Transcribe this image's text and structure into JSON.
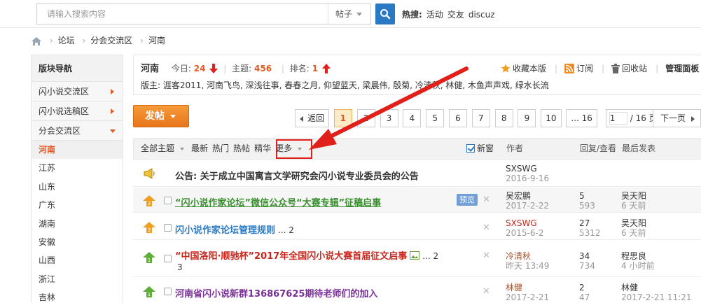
{
  "search": {
    "placeholder": "请输入搜索内容",
    "type": "帖子"
  },
  "hot": {
    "label": "热搜:",
    "items": [
      "活动",
      "交友",
      "discuz"
    ]
  },
  "breadcrumb": [
    "论坛",
    "分会交流区",
    "河南"
  ],
  "sidebar": {
    "title": "版块导航",
    "groups": [
      "闪小说交流区",
      "闪小说选稿区",
      "分会交流区"
    ],
    "items": [
      "河南",
      "江苏",
      "山东",
      "广东",
      "湖南",
      "安徽",
      "山西",
      "浙江",
      "吉林"
    ]
  },
  "forum": {
    "name": "河南",
    "today_label": "今日:",
    "today": "24",
    "topics_label": "主题:",
    "topics": "456",
    "rank_label": "排名:",
    "rank": "1",
    "moderators": "版主: 涯客2011, 河南飞鸟, 深浅往事, 春春之月, 仰望蓝天, 梁晨伟, 殷菊, 冷清秋, 林健, 木鱼声声戏, 绿水长流",
    "actions": {
      "favorite": "收藏本版",
      "subscribe": "订阅",
      "recycle": "回收站",
      "admin": "管理面板"
    }
  },
  "post_button": "发帖",
  "pagination": {
    "back": "返回",
    "pages": [
      "1",
      "2",
      "3",
      "4",
      "5",
      "6",
      "7",
      "8",
      "9",
      "10",
      "... 16"
    ],
    "current": "1",
    "input_value": "1",
    "total": "/ 16 页",
    "next": "下一页"
  },
  "thread_header": {
    "filters": [
      "全部主题",
      "最新",
      "热门",
      "热帖",
      "精华",
      "更多"
    ],
    "new_window": "新窗",
    "author": "作者",
    "replies": "回复/查看",
    "last_post": "最后发表"
  },
  "threads": [
    {
      "title": "公告: 关于成立中国寓言文学研究会闪小说专业委员会的公告",
      "author": "SXSWG",
      "date": "2016-9-16"
    },
    {
      "title": "“闪小说作家论坛”微信公众号“大赛专辑”征稿启事",
      "preview": "预览",
      "author": "吴宏鹏",
      "date": "2017-2-22",
      "replies": "5",
      "views": "593",
      "last_author": "吴天阳",
      "last_time": "6 天前"
    },
    {
      "title": "闪小说作家论坛管理规则",
      "pages": "... 2",
      "author": "SXSWG",
      "date": "2015-6-2",
      "replies": "27",
      "views": "5312",
      "last_author": "吴天阳",
      "last_time": "6 天前"
    },
    {
      "title": "“中国洛阳·顺驰杯”2017年全国闪小说大赛首届征文启事",
      "pages": "... 2",
      "extra": "3",
      "author": "冷清秋",
      "date": "昨天 13:49",
      "replies": "34",
      "views": "734",
      "last_author": "程思良",
      "last_time": "4 小时前"
    },
    {
      "title": "河南省闪小说新群136867625期待老师们的加入",
      "author": "林健",
      "date": "2017-2-21",
      "replies": "2",
      "views": "47",
      "last_author": "林健",
      "last_time": "2017-2-21 11:21"
    }
  ],
  "colors": {
    "accent": "#e05b26",
    "link_blue": "#2a79c4",
    "annotation": "#e0201a"
  }
}
